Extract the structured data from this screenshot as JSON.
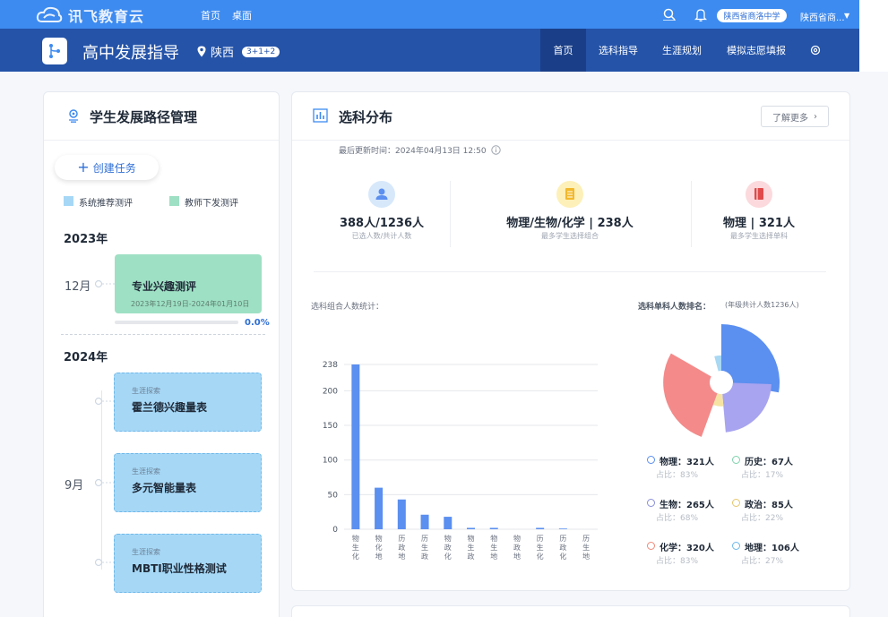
{
  "topbar": {
    "logo_text": "讯飞教育云",
    "links": [
      "首页",
      "桌面"
    ],
    "school": "陕西省商洛中学",
    "user": "陕西省商..."
  },
  "navbar": {
    "title": "高中发展指导",
    "location": "陕西",
    "badge": "3+1+2",
    "items": [
      "首页",
      "选科指导",
      "生涯规划",
      "模拟志愿填报"
    ]
  },
  "left": {
    "title": "学生发展路径管理",
    "create": "创建任务",
    "legend": [
      "系统推荐测评",
      "教师下发测评"
    ],
    "legend_colors": [
      "#a6d8f6",
      "#9ee0c4"
    ],
    "year1": "2023年",
    "month1": "12月",
    "task1": {
      "name": "专业兴趣测评",
      "dates": "2023年12月19日-2024年01月10日",
      "progress_text": "0.0%",
      "progress": 0
    },
    "year2": "2024年",
    "month2": "9月",
    "tasks": [
      {
        "tag": "生涯探索",
        "name": "霍兰德兴趣量表"
      },
      {
        "tag": "生涯探索",
        "name": "多元智能量表"
      },
      {
        "tag": "生涯探索",
        "name": "MBTI职业性格测试"
      }
    ]
  },
  "right": {
    "title": "选科分布",
    "more": "了解更多",
    "updated": "最后更新时间：2024年04月13日 12:50",
    "stats": [
      {
        "value": "388人/1236人",
        "label": "已选人数/共计人数",
        "color": "#d7e8fb",
        "icon": "user-icon"
      },
      {
        "value": "物理/生物/化学 | 238人",
        "label": "最多学生选择组合",
        "color": "#fdf0b8",
        "icon": "book-icon"
      },
      {
        "value": "物理 | 321人",
        "label": "最多学生选择单科",
        "color": "#fbd9dc",
        "icon": "document-icon"
      }
    ],
    "bar_label": "选科组合人数统计：",
    "pie_label": "选科单科人数排名：",
    "pie_note": "(年级共计人数1236人)"
  },
  "chart_data": [
    {
      "type": "bar",
      "categories": [
        "物生化",
        "物化地",
        "历政地",
        "历生政",
        "物政化",
        "物生政",
        "物生地",
        "物政地",
        "历生化",
        "历政化",
        "历生地"
      ],
      "values": [
        238,
        60,
        43,
        21,
        18,
        2,
        2,
        0,
        2,
        1,
        0
      ],
      "yticks": [
        0,
        50,
        100,
        150,
        200,
        238
      ],
      "ylim": [
        0,
        238
      ],
      "color": "#5b8ff0",
      "grid": true
    },
    {
      "type": "pie",
      "variant": "rose",
      "labels": [
        "物理",
        "历史",
        "生物",
        "政治",
        "化学",
        "地理"
      ],
      "values": [
        321,
        67,
        265,
        85,
        320,
        106
      ],
      "percent_labels": [
        "占比：83%",
        "占比：17%",
        "占比：68%",
        "占比：22%",
        "占比：83%",
        "占比：27%"
      ],
      "name_labels": [
        "物理：321人",
        "历史：67人",
        "生物：265人",
        "政治：85人",
        "化学：320人",
        "地理：106人"
      ],
      "colors": [
        "#5b8ff0",
        "#9be3c6",
        "#a8a4ef",
        "#f6e3a3",
        "#f48a8a",
        "#a8d8f3"
      ],
      "ring_colors": [
        "#5b8ff0",
        "#7fd3ad",
        "#8a8fd8",
        "#e6c66b",
        "#f08a7a",
        "#6fb8ea"
      ]
    }
  ]
}
